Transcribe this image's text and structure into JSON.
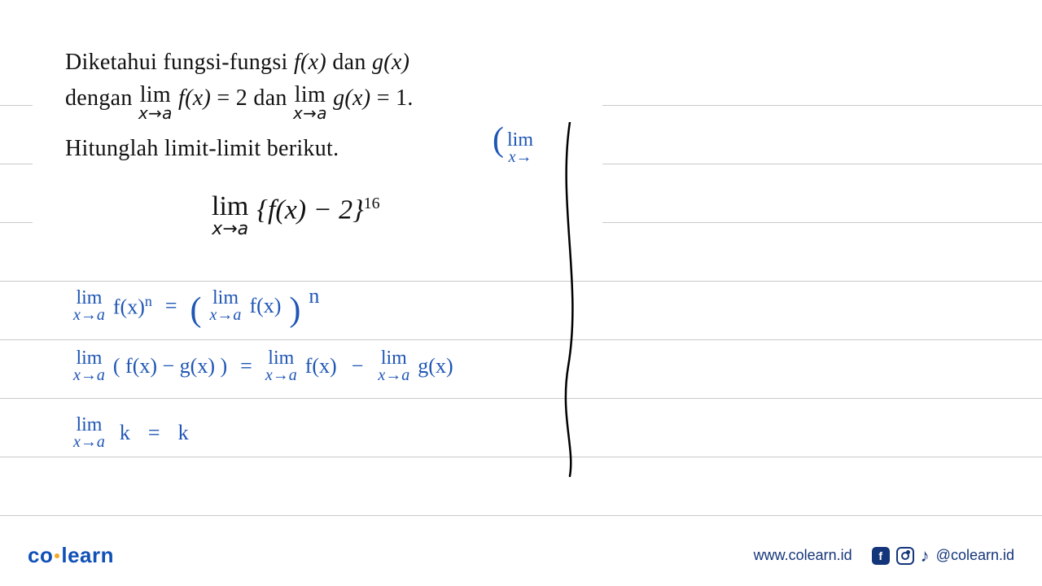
{
  "problem": {
    "line1_a": "Diketahui fungsi-fungsi ",
    "fx": "f(x)",
    "and1": " dan ",
    "gx": "g(x)",
    "line2_a": "dengan ",
    "lim_word": "lim",
    "xtoa": "x→a",
    "eq2": " = 2 dan ",
    "eq1": " = 1.",
    "line3": "Hitunglah limit-limit berikut.",
    "main_body": "{f(x) − 2}",
    "main_exp": "16"
  },
  "handwriting": {
    "top_right_open": "(",
    "top_right_lim": "lim",
    "top_right_sub": "x→",
    "r1_lhs_fxn": "f(x)",
    "r1_n": "n",
    "eq": "=",
    "r1_rhs_fx": "f(x)",
    "r2_lhs": "( f(x) − g(x) )",
    "r2_rhs_fx": "f(x)",
    "minus": "−",
    "r2_rhs_gx": "g(x)",
    "r3_lhs_k": "k",
    "r3_rhs_k": "k"
  },
  "footer": {
    "brand_co": "co",
    "brand_learn": "learn",
    "url": "www.colearn.id",
    "handle": "@colearn.id"
  },
  "colors": {
    "ink": "#1f56b5",
    "print": "#111111",
    "rule": "#c9c9c9",
    "brand": "#1151b7",
    "accent": "#f5a623",
    "footer": "#15357a"
  }
}
